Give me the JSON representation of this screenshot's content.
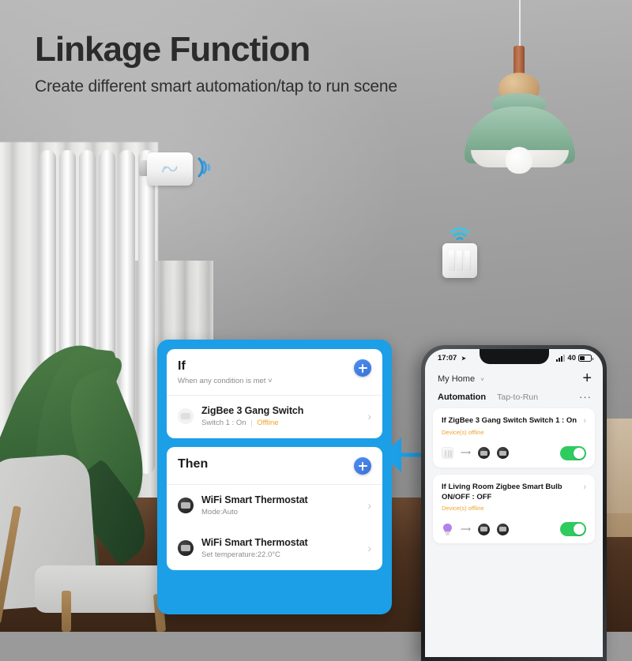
{
  "headline": {
    "title": "Linkage Function",
    "subtitle": "Create different smart automation/tap to run scene"
  },
  "colors": {
    "card_blue": "#1c9fe6",
    "plus_blue": "#3a72d8",
    "offline_orange": "#f0a22e",
    "toggle_green": "#2ecb5f"
  },
  "automation_card": {
    "if_section": {
      "title": "If",
      "subtitle": "When any condition is met",
      "caret": "˅",
      "add_label": "+",
      "devices": [
        {
          "name": "ZigBee 3 Gang Switch",
          "state": "Switch 1 : On",
          "separator": "|",
          "status": "Offline",
          "chevron": "›"
        }
      ]
    },
    "then_section": {
      "title": "Then",
      "add_label": "+",
      "devices": [
        {
          "name": "WiFi Smart Thermostat",
          "state": "Mode:Auto",
          "chevron": "›"
        },
        {
          "name": "WiFi Smart Thermostat",
          "state": "Set temperature:22.0°C",
          "chevron": "›"
        }
      ]
    }
  },
  "phone": {
    "status_bar": {
      "time": "17:07",
      "location_icon": "➤",
      "signal_icon": "signal-bars-icon",
      "battery_level": "40",
      "battery_icon": "battery-icon"
    },
    "header": {
      "home_name": "My Home",
      "caret": "˅",
      "add_button": "+"
    },
    "tabs": [
      {
        "label": "Automation",
        "active": true
      },
      {
        "label": "Tap-to-Run",
        "active": false
      }
    ],
    "more_button": "···",
    "automations": [
      {
        "title": "If ZigBee 3 Gang Switch Switch 1 : On",
        "status": "Device(s) offline",
        "chevron": "›",
        "icons": [
          "switch-panel-icon",
          "arrow-right-icon",
          "thermostat-icon",
          "thermostat-icon"
        ],
        "toggle_on": true
      },
      {
        "title": "If  Living Room Zigbee Smart Bulb ON/OFF : OFF",
        "status": "Device(s) offline",
        "chevron": "›",
        "icons": [
          "light-bulb-icon",
          "arrow-right-icon",
          "thermostat-icon",
          "thermostat-icon"
        ],
        "toggle_on": true
      }
    ]
  },
  "scene": {
    "radiator": "radiator",
    "thermostat_valve": "smart-trv-icon",
    "wall_switch": "wall-switch-3gang",
    "wifi_badge": "wifi-icon",
    "pendant_lamp": "pendant-lamp",
    "plant": "potted-plant",
    "chair": "armchair"
  }
}
